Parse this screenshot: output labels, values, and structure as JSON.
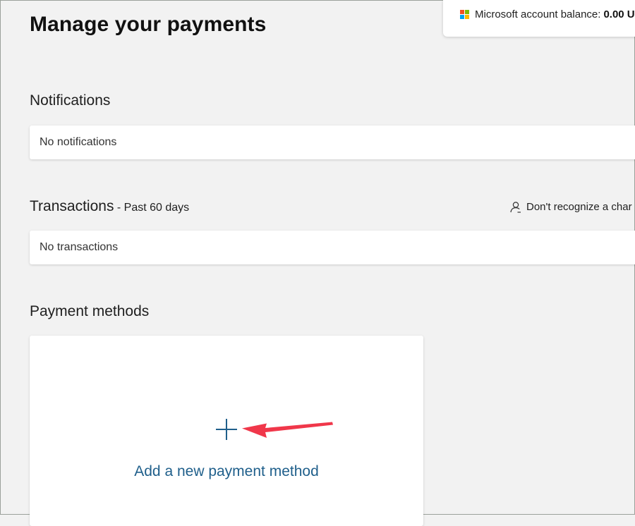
{
  "page": {
    "title": "Manage your payments"
  },
  "balance": {
    "label": "Microsoft account balance:",
    "value": "0.00 U",
    "logo_colors": [
      "#f25022",
      "#7fba00",
      "#00a4ef",
      "#ffb900"
    ]
  },
  "notifications": {
    "title": "Notifications",
    "empty_text": "No notifications"
  },
  "transactions": {
    "title": "Transactions",
    "subtitle": " - Past 60 days",
    "empty_text": "No transactions",
    "help_link": "Don't recognize a char"
  },
  "payment_methods": {
    "title": "Payment methods",
    "add_label": "Add a new payment method"
  },
  "colors": {
    "accent_link": "#1f5f8b",
    "annotation_arrow": "#f0374a"
  },
  "icons": {
    "logo": "microsoft-logo-icon",
    "person": "person-icon",
    "plus": "plus-icon",
    "annotation": "red-arrow-icon"
  }
}
